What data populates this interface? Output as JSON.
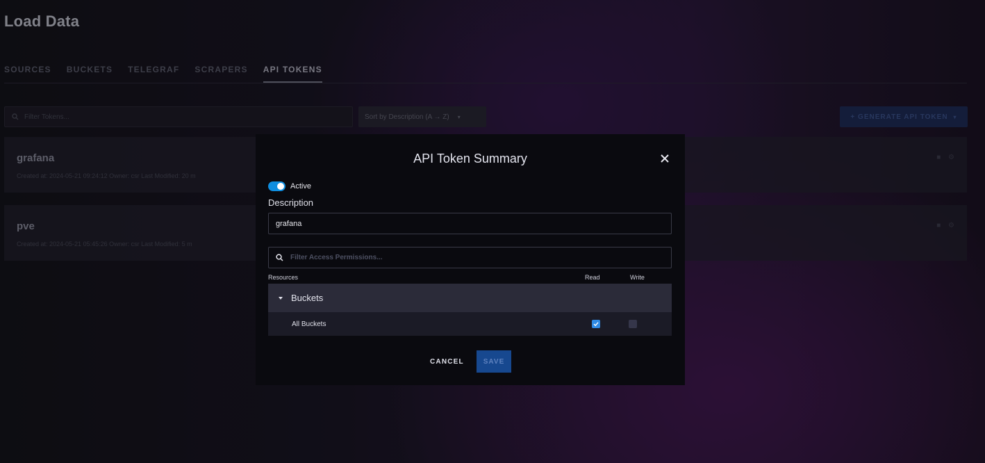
{
  "page": {
    "title": "Load Data"
  },
  "tabs": [
    {
      "label": "SOURCES"
    },
    {
      "label": "BUCKETS"
    },
    {
      "label": "TELEGRAF"
    },
    {
      "label": "SCRAPERS"
    },
    {
      "label": "API TOKENS",
      "active": true
    }
  ],
  "toolbar": {
    "filter_placeholder": "Filter Tokens...",
    "sort_label": "Sort by Description (A → Z)",
    "generate_label": "+ GENERATE API TOKEN"
  },
  "tokens": [
    {
      "name": "grafana",
      "meta": "Created at: 2024-05-21 09:24:12     Owner: csr     Last Modified: 20 m"
    },
    {
      "name": "pve",
      "meta": "Created at: 2024-05-21 05:45:26     Owner: csr     Last Modified: 5 m"
    }
  ],
  "modal": {
    "title": "API Token Summary",
    "active_label": "Active",
    "active": true,
    "description_label": "Description",
    "description_value": "grafana",
    "perm_filter_placeholder": "Filter Access Permissions...",
    "col_resources": "Resources",
    "col_read": "Read",
    "col_write": "Write",
    "group_label": "Buckets",
    "row_label": "All Buckets",
    "read_checked": true,
    "write_checked": false,
    "cancel_label": "CANCEL",
    "save_label": "SAVE"
  },
  "colors": {
    "accent": "#0e8ee0",
    "save_bg": "#17488f",
    "modal_bg": "#0a0a0f"
  }
}
